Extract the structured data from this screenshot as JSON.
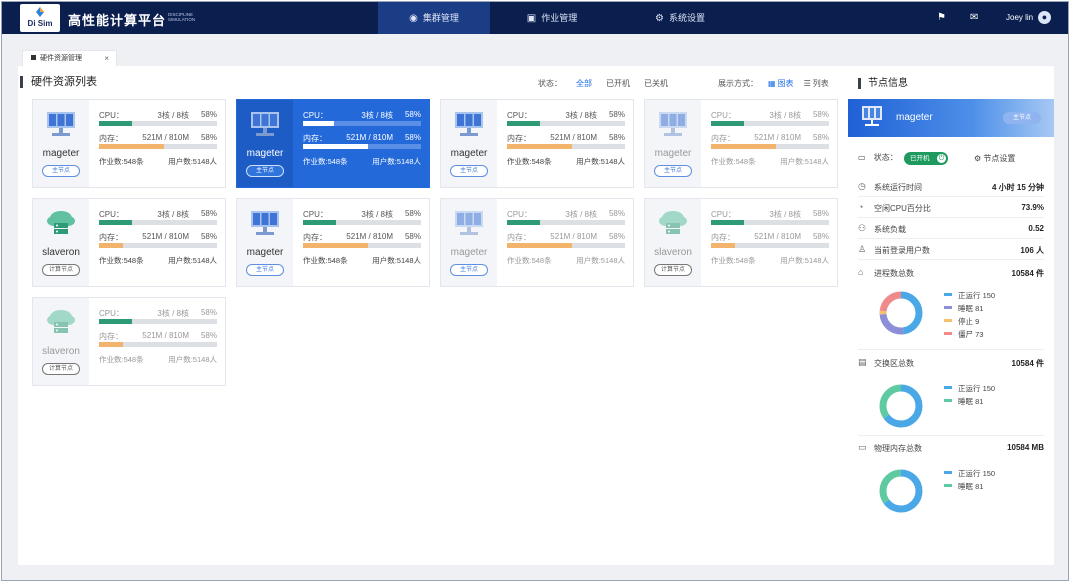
{
  "header": {
    "logo_text": "Di Sim",
    "brand": "高性能计算平台",
    "brand_sub_1": "DISCIPLINE",
    "brand_sub_2": "SIMULATION",
    "nav": [
      {
        "label": "集群管理",
        "icon": "cluster-icon",
        "active": true
      },
      {
        "label": "作业管理",
        "icon": "job-icon",
        "active": false
      },
      {
        "label": "系统设置",
        "icon": "gear-icon",
        "active": false
      }
    ],
    "user_name": "Joey lin"
  },
  "tabs": [
    {
      "label": "硬件资源管理",
      "close": "×"
    }
  ],
  "main": {
    "title": "硬件资源列表",
    "status_label": "状态：",
    "status_filters": [
      "全部",
      "已开机",
      "已关机"
    ],
    "view_label": "展示方式：",
    "view_modes": [
      "图表",
      "列表"
    ],
    "cpu_label": "CPU：",
    "mem_label": "内存：",
    "cards": [
      {
        "name": "mageter",
        "type": "主节点",
        "kind": "master",
        "state": "on",
        "selected": false,
        "cpu_cores": "3核 / 8核",
        "cpu_pct": "58%",
        "cpu_fill": 0.28,
        "mem": "521M / 810M",
        "mem_pct": "58%",
        "mem_fill": 0.55,
        "jobs": "作业数:548条",
        "users": "用户数:5148人"
      },
      {
        "name": "mageter",
        "type": "主节点",
        "kind": "master",
        "state": "on",
        "selected": true,
        "cpu_cores": "3核 / 8核",
        "cpu_pct": "58%",
        "cpu_fill": 0.26,
        "mem": "521M / 810M",
        "mem_pct": "58%",
        "mem_fill": 0.55,
        "jobs": "作业数:548条",
        "users": "用户数:5148人"
      },
      {
        "name": "mageter",
        "type": "主节点",
        "kind": "master",
        "state": "on",
        "selected": false,
        "cpu_cores": "3核 / 8核",
        "cpu_pct": "58%",
        "cpu_fill": 0.28,
        "mem": "521M / 810M",
        "mem_pct": "58%",
        "mem_fill": 0.55,
        "jobs": "作业数:548条",
        "users": "用户数:5148人"
      },
      {
        "name": "mageter",
        "type": "主节点",
        "kind": "master",
        "state": "off",
        "selected": false,
        "cpu_cores": "3核 / 8核",
        "cpu_pct": "58%",
        "cpu_fill": 0.28,
        "mem": "521M / 810M",
        "mem_pct": "58%",
        "mem_fill": 0.55,
        "jobs": "作业数:548条",
        "users": "用户数:5148人"
      },
      {
        "name": "slaveron",
        "type": "计算节点",
        "kind": "compute",
        "state": "on",
        "selected": false,
        "cpu_cores": "3核 / 8核",
        "cpu_pct": "58%",
        "cpu_fill": 0.28,
        "mem": "521M / 810M",
        "mem_pct": "58%",
        "mem_fill": 0.2,
        "jobs": "作业数:548条",
        "users": "用户数:5148人"
      },
      {
        "name": "mageter",
        "type": "主节点",
        "kind": "master",
        "state": "on",
        "selected": false,
        "cpu_cores": "3核 / 8核",
        "cpu_pct": "58%",
        "cpu_fill": 0.28,
        "mem": "521M / 810M",
        "mem_pct": "58%",
        "mem_fill": 0.55,
        "jobs": "作业数:548条",
        "users": "用户数:5148人"
      },
      {
        "name": "mageter",
        "type": "主节点",
        "kind": "master",
        "state": "off",
        "selected": false,
        "cpu_cores": "3核 / 8核",
        "cpu_pct": "58%",
        "cpu_fill": 0.28,
        "mem": "521M / 810M",
        "mem_pct": "58%",
        "mem_fill": 0.55,
        "jobs": "作业数:548条",
        "users": "用户数:5148人"
      },
      {
        "name": "slaveron",
        "type": "计算节点",
        "kind": "compute",
        "state": "off",
        "selected": false,
        "cpu_cores": "3核 / 8核",
        "cpu_pct": "58%",
        "cpu_fill": 0.28,
        "mem": "521M / 810M",
        "mem_pct": "58%",
        "mem_fill": 0.2,
        "jobs": "作业数:548条",
        "users": "用户数:5148人"
      },
      {
        "name": "slaveron",
        "type": "计算节点",
        "kind": "compute",
        "state": "off",
        "selected": false,
        "cpu_cores": "3核 / 8核",
        "cpu_pct": "58%",
        "cpu_fill": 0.28,
        "mem": "521M / 810M",
        "mem_pct": "58%",
        "mem_fill": 0.2,
        "jobs": "作业数:548条",
        "users": "用户数:5148人"
      }
    ]
  },
  "side": {
    "title": "节点信息",
    "node_name": "mageter",
    "node_badge": "主节点",
    "status_label": "状态：",
    "status_value": "已开机",
    "setting_label": "节点设置",
    "metrics": [
      {
        "label": "系统运行时间",
        "value": "4 小时 15 分钟",
        "icon": "clock-icon"
      },
      {
        "label": "空闲CPU百分比",
        "value": "73.9%",
        "icon": "pie-icon"
      },
      {
        "label": "系统负载",
        "value": "0.52",
        "icon": "network-icon"
      },
      {
        "label": "当前登录用户数",
        "value": "106 人",
        "icon": "user-icon"
      }
    ],
    "process": {
      "label": "进程数总数",
      "value": "10584 件",
      "legend": [
        {
          "label": "正运行 150",
          "value": 150,
          "color": "#4aa8e6"
        },
        {
          "label": "睡眠 81",
          "value": 81,
          "color": "#8c8fd8"
        },
        {
          "label": "停止 9",
          "value": 9,
          "color": "#f6c16b"
        },
        {
          "label": "僵尸 73",
          "value": 73,
          "color": "#f08a8a"
        }
      ]
    },
    "swap": {
      "label": "交换区总数",
      "value": "10584 件",
      "legend": [
        {
          "label": "正运行 150",
          "value": 150,
          "color": "#4aa8e6"
        },
        {
          "label": "睡眠 81",
          "value": 81,
          "color": "#5fcaa1"
        }
      ]
    },
    "memory": {
      "label": "物理内存总数",
      "value": "10584 MB",
      "legend": [
        {
          "label": "正运行 150",
          "value": 150,
          "color": "#4aa8e6"
        },
        {
          "label": "睡眠 81",
          "value": 81,
          "color": "#5fcaa1"
        }
      ]
    }
  },
  "colors": {
    "accent": "#2469d9",
    "topbar": "#0b1f4f",
    "cpu": "#2f9b76",
    "mem": "#f2b36d"
  }
}
